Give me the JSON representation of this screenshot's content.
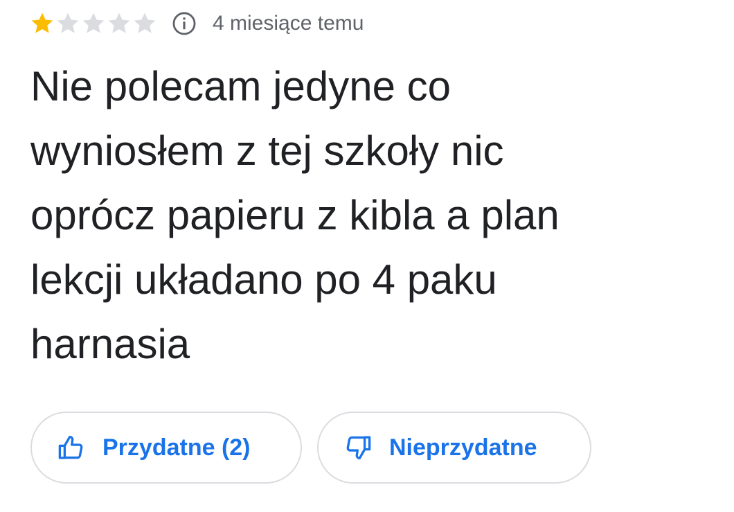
{
  "review": {
    "rating": 1,
    "rating_max": 5,
    "time_ago": "4 miesiące temu",
    "text": "Nie polecam jedyne co\nwyniosłem z tej szkoły nic\noprócz papieru z kibla a plan\nlekcji układano po 4 paku\nharnasia"
  },
  "actions": {
    "helpful_label": "Przydatne (2)",
    "unhelpful_label": "Nieprzydatne"
  },
  "colors": {
    "star_filled": "#fbbc04",
    "star_empty": "#dadce0",
    "accent": "#1a73e8",
    "meta_text": "#5f6368"
  },
  "icons": {
    "info": "info-icon",
    "thumb_up": "thumb-up-icon",
    "thumb_down": "thumb-down-icon",
    "star": "star-icon"
  }
}
